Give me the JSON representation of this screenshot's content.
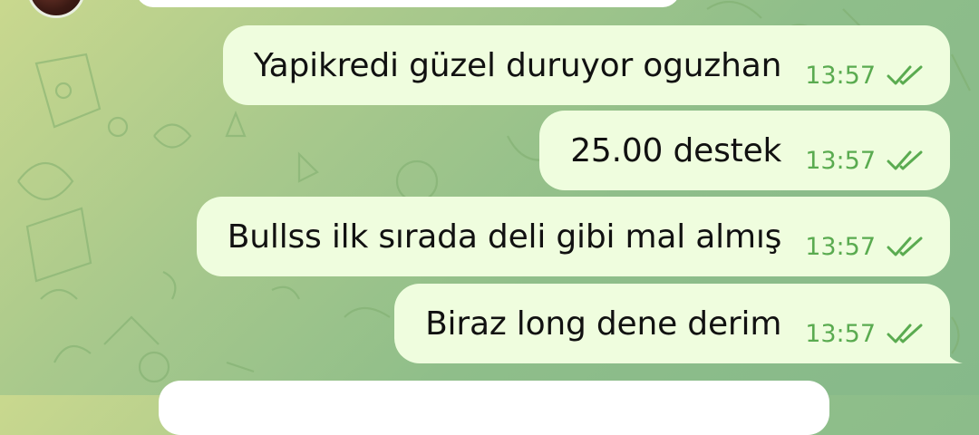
{
  "chat": {
    "messages": [
      {
        "text": "Yapikredi güzel duruyor oguzhan",
        "time": "13:57",
        "status_icon": "double-check-icon"
      },
      {
        "text": "25.00 destek",
        "time": "13:57",
        "status_icon": "double-check-icon"
      },
      {
        "text": "Bullss ilk sırada deli gibi mal almış",
        "time": "13:57",
        "status_icon": "double-check-icon"
      },
      {
        "text": "Biraz long dene derim",
        "time": "13:57",
        "status_icon": "double-check-icon"
      }
    ]
  },
  "colors": {
    "outgoing_bubble": "#effdde",
    "incoming_bubble": "#ffffff",
    "time_text": "#5aab50",
    "check_color": "#5aab50"
  }
}
